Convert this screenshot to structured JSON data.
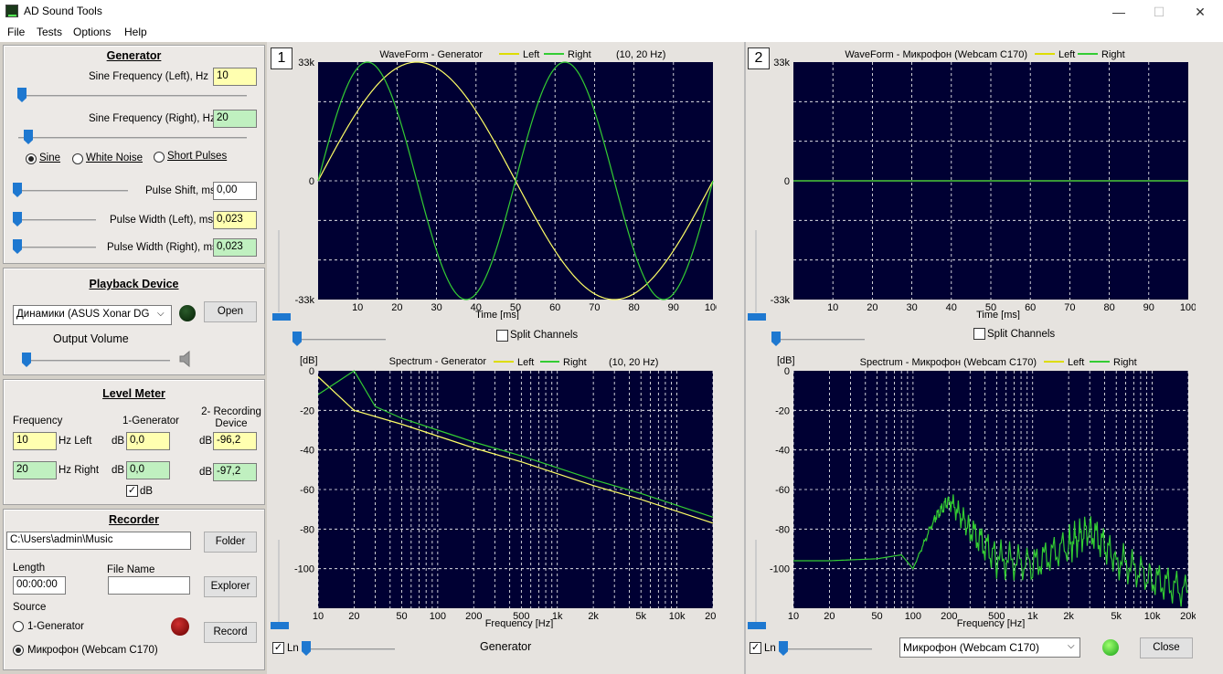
{
  "window": {
    "title": "AD Sound Tools",
    "minimize": "—",
    "maximize": "☐",
    "close": "✕"
  },
  "menu": [
    "File",
    "Tests",
    "Options",
    "Help"
  ],
  "generator": {
    "title": "Generator",
    "sine_left_label": "Sine Frequency  (Left),  Hz",
    "sine_left_value": "10",
    "sine_right_label": "Sine Frequency (Right), Hz",
    "sine_right_value": "20",
    "wave_options": [
      "Sine",
      "White Noise",
      "Short Pulses"
    ],
    "selected_wave": "Sine",
    "pulse_shift_label": "Pulse Shift, ms",
    "pulse_shift_value": "0,00",
    "pulse_width_left_label": "Pulse Width  (Left), ms",
    "pulse_width_left_value": "0,023",
    "pulse_width_right_label": "Pulse Width (Right), ms",
    "pulse_width_right_value": "0,023"
  },
  "playback": {
    "title": "Playback Device",
    "device": "Динамики (ASUS Xonar DG",
    "open_label": "Open",
    "output_volume_label": "Output Volume"
  },
  "level_meter": {
    "title": "Level Meter",
    "frequency_label": "Frequency",
    "gen_label": "1-Generator",
    "rec_label": "2- Recording Device",
    "left_freq": "10",
    "left_unit": "Hz  Left",
    "right_freq": "20",
    "right_unit": "Hz  Right",
    "db_label": "dB",
    "gen_left_db": "0,0",
    "gen_right_db": "0,0",
    "rec_left_db": "-96,2",
    "rec_right_db": "-97,2",
    "db_checkbox": "dB"
  },
  "recorder": {
    "title": "Recorder",
    "path": "C:\\Users\\admin\\Music",
    "folder_label": "Folder",
    "length_label": "Length",
    "length_value": "00:00:00",
    "file_name_label": "File Name",
    "file_name_value": "",
    "explorer_label": "Explorer",
    "source_label": "Source",
    "sources": [
      "1-Generator",
      "Микрофон (Webcam C170)"
    ],
    "selected_source": "Микрофон (Webcam C170)",
    "record_label": "Record"
  },
  "panel1": {
    "badge": "1",
    "wave_title": "WaveForm - Generator",
    "legend_left": "Left",
    "legend_right": "Right",
    "info": "(10, 20 Hz)",
    "split_label": "Split Channels",
    "spec_title": "Spectrum - Generator",
    "ln_label": "Ln",
    "footer_label": "Generator"
  },
  "panel2": {
    "badge": "2",
    "wave_title": "WaveForm - Микрофон (Webcam C170)",
    "legend_left": "Left",
    "legend_right": "Right",
    "split_label": "Split Channels",
    "spec_title": "Spectrum - Микрофон (Webcam C170)",
    "ln_label": "Ln",
    "device": "Микрофон (Webcam C170)",
    "close_label": "Close"
  },
  "colors": {
    "plot_bg": "#000033",
    "left": "#ffff66",
    "right": "#33cc33",
    "grid": "#ffffff"
  },
  "chart_data": [
    {
      "type": "line",
      "title": "WaveForm - Generator",
      "xlabel": "Time [ms]",
      "ylabel": "",
      "xlim": [
        0,
        100
      ],
      "ylim": [
        -33000,
        33000
      ],
      "x_ticks": [
        "10",
        "20",
        "30",
        "40",
        "50",
        "60",
        "70",
        "80",
        "90",
        "100"
      ],
      "y_ticks": [
        "33k",
        "0",
        "-33k"
      ],
      "series": [
        {
          "name": "Left",
          "function": "sine",
          "frequency_hz": 10,
          "amplitude": 33000
        },
        {
          "name": "Right",
          "function": "sine",
          "frequency_hz": 20,
          "amplitude": 33000
        }
      ]
    },
    {
      "type": "line",
      "title": "Spectrum - Generator",
      "xlabel": "Frequency [Hz]",
      "ylabel": "[dB]",
      "xscale": "log",
      "xlim": [
        10,
        20000
      ],
      "ylim": [
        -120,
        0
      ],
      "x_ticks": [
        "10",
        "20",
        "50",
        "100",
        "200",
        "500",
        "1k",
        "2k",
        "5k",
        "10k",
        "20k"
      ],
      "y_ticks": [
        "0",
        "-20",
        "-40",
        "-60",
        "-80",
        "-100"
      ],
      "series": [
        {
          "name": "Left",
          "x": [
            10,
            20,
            50,
            100,
            200,
            500,
            1000,
            2000,
            5000,
            10000,
            20000
          ],
          "y": [
            -3,
            -20,
            -27,
            -33,
            -39,
            -46,
            -52,
            -58,
            -65,
            -71,
            -77
          ]
        },
        {
          "name": "Right",
          "x": [
            10,
            15,
            20,
            30,
            50,
            100,
            200,
            500,
            1000,
            2000,
            5000,
            10000,
            20000
          ],
          "y": [
            -12,
            -5,
            0,
            -18,
            -24,
            -30,
            -36,
            -43,
            -49,
            -55,
            -62,
            -68,
            -74
          ]
        }
      ]
    },
    {
      "type": "line",
      "title": "WaveForm - Микрофон (Webcam C170)",
      "xlabel": "Time [ms]",
      "xlim": [
        0,
        100
      ],
      "ylim": [
        -33000,
        33000
      ],
      "x_ticks": [
        "10",
        "20",
        "30",
        "40",
        "50",
        "60",
        "70",
        "80",
        "90",
        "100"
      ],
      "y_ticks": [
        "33k",
        "0",
        "-33k"
      ],
      "series": [
        {
          "name": "Left",
          "values": "flat at 0"
        },
        {
          "name": "Right",
          "values": "flat at 0"
        }
      ]
    },
    {
      "type": "line",
      "title": "Spectrum - Микрофон (Webcam C170)",
      "xlabel": "Frequency [Hz]",
      "ylabel": "[dB]",
      "xscale": "log",
      "xlim": [
        10,
        20000
      ],
      "ylim": [
        -120,
        0
      ],
      "x_ticks": [
        "10",
        "20",
        "50",
        "100",
        "200",
        "500",
        "1k",
        "2k",
        "5k",
        "10k",
        "20k"
      ],
      "y_ticks": [
        "0",
        "-20",
        "-40",
        "-60",
        "-80",
        "-100"
      ],
      "series": [
        {
          "name": "Right",
          "x": [
            10,
            20,
            50,
            80,
            100,
            150,
            200,
            300,
            500,
            1000,
            2000,
            3000,
            5000,
            10000,
            20000
          ],
          "y": [
            -96,
            -96,
            -95,
            -93,
            -100,
            -75,
            -65,
            -80,
            -95,
            -98,
            -88,
            -80,
            -95,
            -105,
            -112
          ]
        }
      ]
    }
  ]
}
